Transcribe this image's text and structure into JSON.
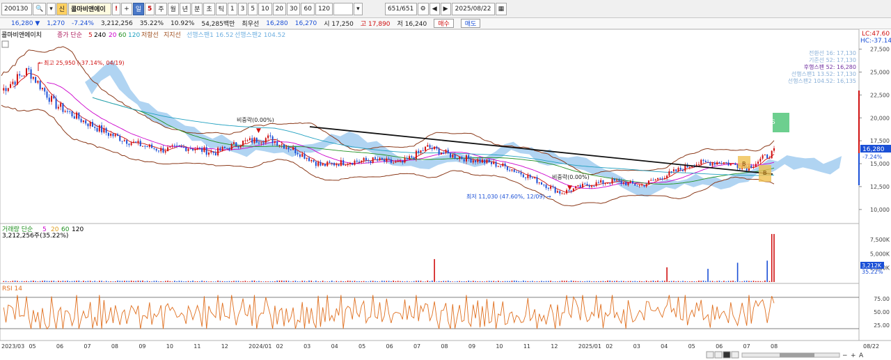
{
  "toolbar": {
    "code": "200130",
    "name": "콜마비앤에이",
    "name_tag": "신",
    "btn_excl": "!",
    "btn_plus": "+",
    "period_badge": "일",
    "period_num": "5",
    "periods": [
      "주",
      "월",
      "년",
      "분",
      "초",
      "틱"
    ],
    "intervals": [
      "1",
      "3",
      "5",
      "10",
      "20",
      "30",
      "60",
      "120"
    ],
    "count": "651/651",
    "date": "2025/08/22"
  },
  "info": {
    "price": "16,280 ▼",
    "change": "1,270",
    "change_pct": "-7.24%",
    "volume": "3,212,256",
    "turnover": "35.22%",
    "ratio": "10.92%",
    "amount": "54,285백만",
    "sell_label": "최우선",
    "best_ask": "16,280",
    "best_bid": "16,270",
    "open": "시 17,250",
    "high": "고 17,890",
    "low": "저 16,240",
    "buy_btn": "매수",
    "sell_btn": "매도"
  },
  "price_panel": {
    "title": "콜마비앤에이치",
    "ma_label": "종가 단순",
    "ma_periods": [
      "5",
      "240",
      "20",
      "60",
      "120"
    ],
    "extra_lines": [
      "저항선",
      "지지선"
    ],
    "ichimoku_labels": [
      "선행스팬1 16.52",
      "선행스팬2 104.52"
    ],
    "lc": "LC:47.60",
    "hc": "HC:-37.14",
    "high_annot": "최고 25,950 (-37.14%, 04/19)",
    "low_annot": "최저 11,030 (47.60%, 12/09)",
    "break_annot_1": "비중락(0.00%)",
    "break_annot_2": "비중락(0.00%)",
    "legend_right": [
      "전환선 16: 17,130",
      "기준선 52: 17,130",
      "후행스팬 52: 16,280",
      "선행스팬1 13.52: 17,130",
      "선행스팬2 104.52: 16,135"
    ],
    "current_price": "16,280",
    "current_pct": "-7.24%",
    "y_ticks": [
      "27,500",
      "25,000",
      "22,500",
      "20,000",
      "17,500",
      "15,000",
      "12,500",
      "10,000"
    ],
    "marker_s": "S",
    "marker_b": "B"
  },
  "volume_panel": {
    "title": "거래량 단순",
    "ma_periods": [
      "5",
      "20",
      "60",
      "120"
    ],
    "subtitle": "3,212,256주(35.22%)",
    "y_ticks": [
      "7,500K",
      "5,000K",
      "2,500K"
    ],
    "current": "3,212K",
    "current_pct": "35.22%"
  },
  "rsi_panel": {
    "title": "RSI 14",
    "y_ticks": [
      "75.00",
      "50.00",
      "25.00"
    ]
  },
  "x_axis": [
    "2023/03",
    "05",
    "06",
    "07",
    "08",
    "09",
    "10",
    "11",
    "12",
    "2024/01",
    "02",
    "03",
    "04",
    "05",
    "06",
    "07",
    "08",
    "09",
    "10",
    "11",
    "12",
    "2025/01",
    "02",
    "03",
    "04",
    "05",
    "06",
    "07",
    "08",
    "08/22"
  ],
  "colors": {
    "up": "#d01010",
    "down": "#1a4fd6",
    "bollinger": "#8b3a1a",
    "ichimoku_cloud": "#6fb0e8",
    "rsi": "#e07020",
    "trendline": "#111111"
  },
  "chart_data": {
    "type": "line",
    "title": "콜마비앤에이치",
    "series": [
      {
        "name": "종가",
        "x": [
          "2023/03",
          "2023/04",
          "2023/05",
          "2023/06",
          "2023/07",
          "2023/08",
          "2023/09",
          "2023/10",
          "2023/11",
          "2023/12",
          "2024/01",
          "2024/02",
          "2024/03",
          "2024/04",
          "2024/05",
          "2024/06",
          "2024/07",
          "2024/08",
          "2024/09",
          "2024/10",
          "2024/11",
          "2024/12",
          "2025/01",
          "2025/02",
          "2025/03",
          "2025/04",
          "2025/05",
          "2025/06",
          "2025/07",
          "2025/08"
        ],
        "values": [
          23000,
          25200,
          21500,
          19800,
          18300,
          17200,
          16500,
          16800,
          16200,
          17300,
          17800,
          16500,
          14800,
          15200,
          15400,
          15000,
          16800,
          15800,
          15300,
          14600,
          13300,
          11800,
          12700,
          13100,
          12600,
          13800,
          15000,
          15200,
          14600,
          16280
        ]
      }
    ],
    "ylim": [
      9000,
      28000
    ],
    "rsi_ylim": [
      0,
      100
    ]
  }
}
